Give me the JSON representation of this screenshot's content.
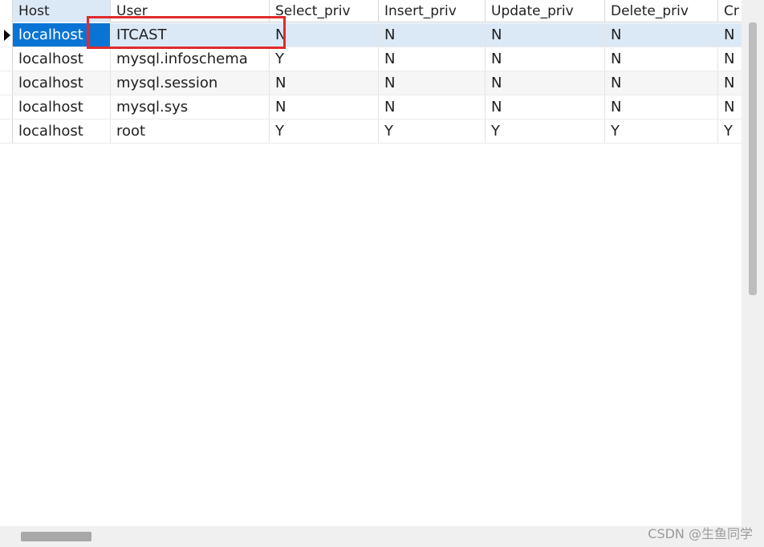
{
  "table": {
    "columns": [
      "Host",
      "User",
      "Select_priv",
      "Insert_priv",
      "Update_priv",
      "Delete_priv",
      "Cr"
    ],
    "rows": [
      [
        "localhost",
        "ITCAST",
        "N",
        "N",
        "N",
        "N",
        "N"
      ],
      [
        "localhost",
        "mysql.infoschema",
        "Y",
        "N",
        "N",
        "N",
        "N"
      ],
      [
        "localhost",
        "mysql.session",
        "N",
        "N",
        "N",
        "N",
        "N"
      ],
      [
        "localhost",
        "mysql.sys",
        "N",
        "N",
        "N",
        "N",
        "N"
      ],
      [
        "localhost",
        "root",
        "Y",
        "Y",
        "Y",
        "Y",
        "Y"
      ]
    ],
    "selected_row": 0,
    "selected_column": "Host"
  },
  "watermark": "CSDN @生鱼同学",
  "colors": {
    "selection": "#0a74d4",
    "row_highlight": "#dbe9f7",
    "annotation_box": "#e12b2b"
  }
}
